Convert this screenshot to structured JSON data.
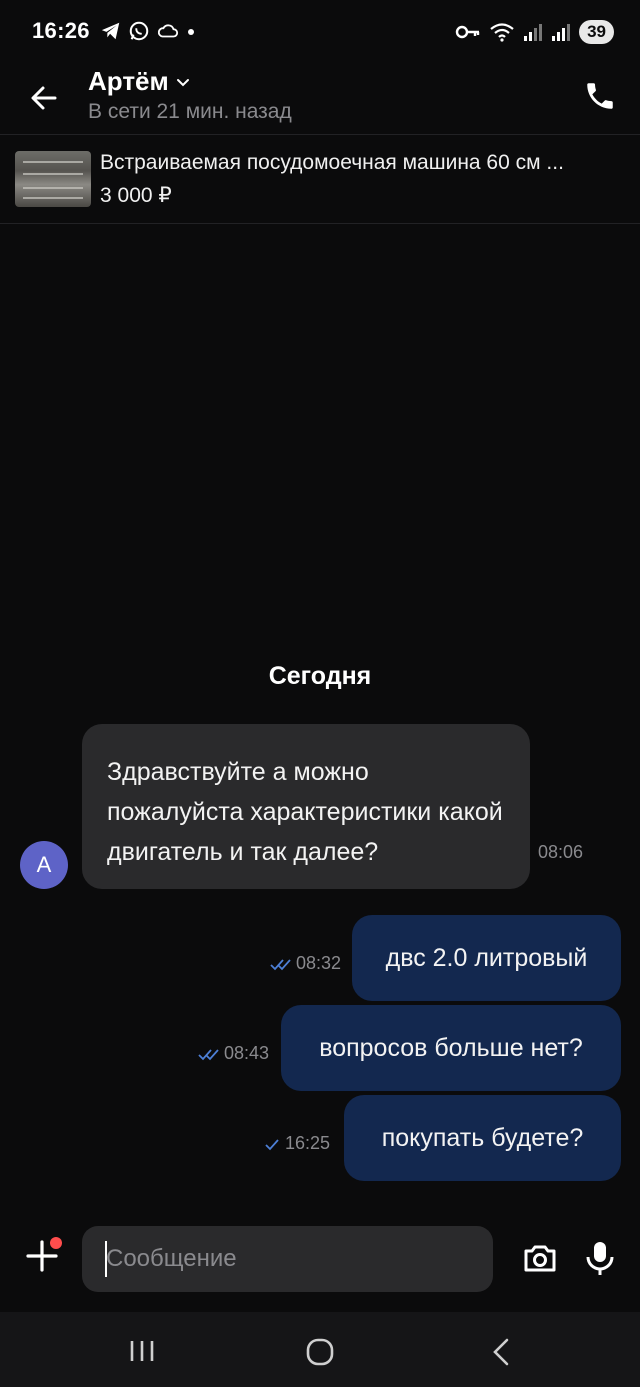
{
  "status_bar": {
    "time": "16:26",
    "battery": "39",
    "left_icons": [
      "telegram-icon",
      "whatsapp-icon",
      "cloud-icon",
      "dot-icon"
    ],
    "right_icons": [
      "key-icon",
      "wifi-icon",
      "signal-icon",
      "signal-icon"
    ]
  },
  "header": {
    "contact_name": "Артём",
    "contact_status": "В сети 21 мин. назад"
  },
  "listing": {
    "title": "Встраиваемая посудомоечная машина 60 см ...",
    "price": "3 000 ₽"
  },
  "chat": {
    "date_separator": "Сегодня",
    "avatar_letter": "A",
    "messages": [
      {
        "direction": "in",
        "text": "Здравствуйте а можно пожалуйста характеристики какой двигатель и так далее?",
        "time": "08:06"
      },
      {
        "direction": "out",
        "text": "двс 2.0 литровый",
        "time": "08:32",
        "status": "read"
      },
      {
        "direction": "out",
        "text": "вопросов больше нет?",
        "time": "08:43",
        "status": "read"
      },
      {
        "direction": "out",
        "text": "покупать будете?",
        "time": "16:25",
        "status": "sent"
      }
    ]
  },
  "input": {
    "placeholder": "Сообщение"
  },
  "colors": {
    "background": "#0b0b0c",
    "incoming_bubble": "#2a2a2c",
    "outgoing_bubble": "#13284f",
    "avatar": "#5e63c7",
    "check": "#4d7fd6",
    "notification_dot": "#ff4d4d"
  }
}
